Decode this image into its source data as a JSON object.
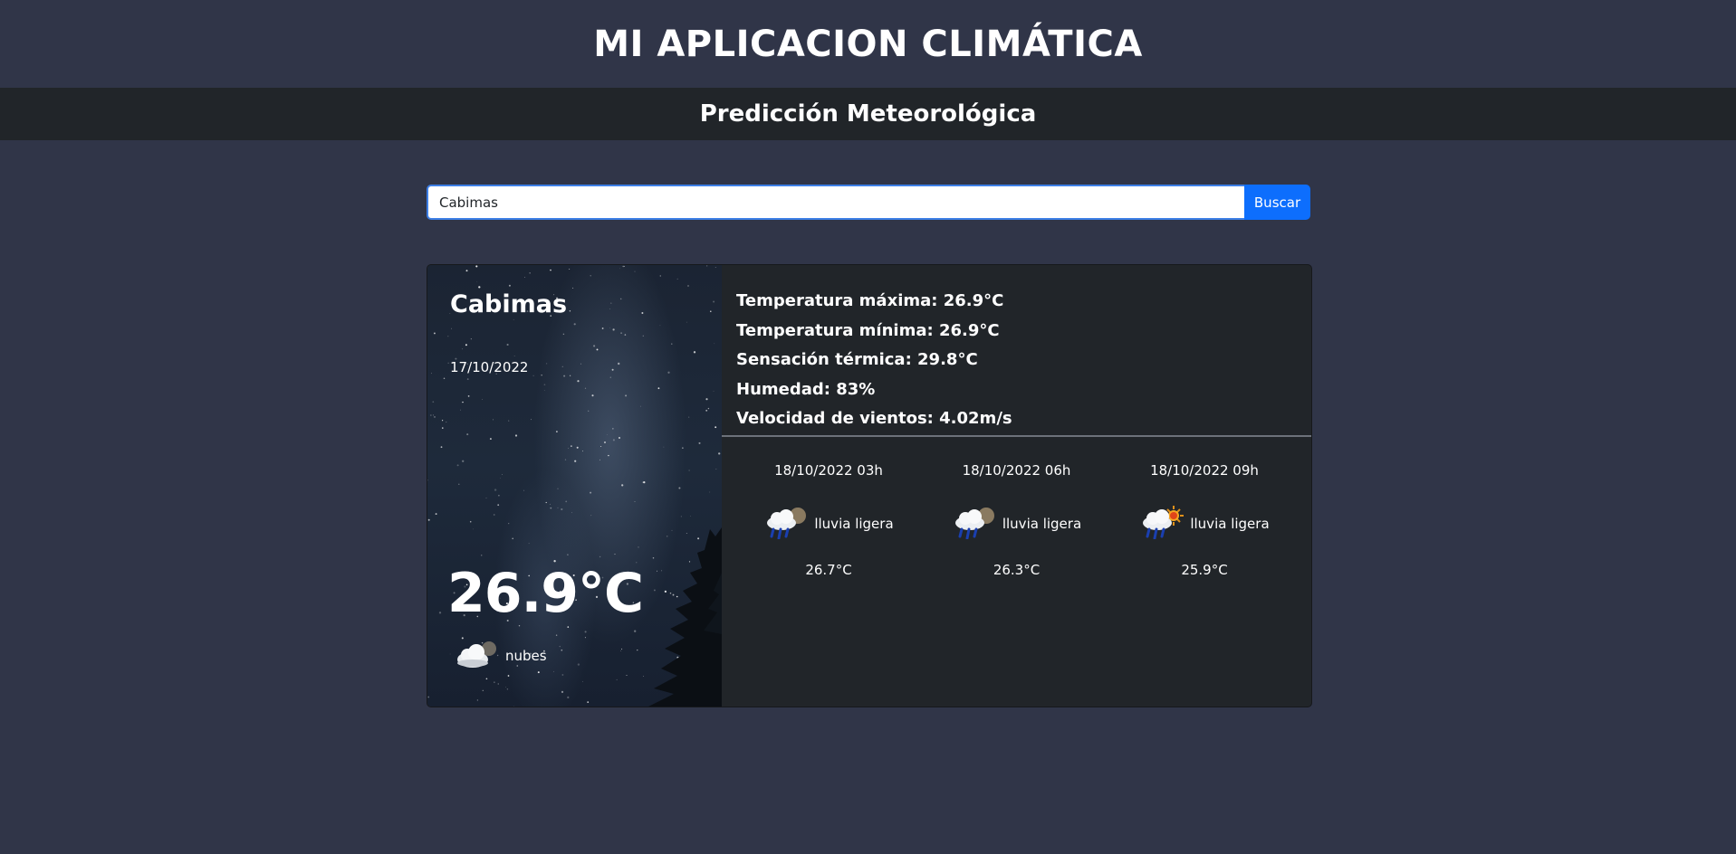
{
  "header": {
    "app_title": "MI APLICACION CLIMÁTICA",
    "subtitle": "Predicción Meteorológica"
  },
  "search": {
    "value": "Cabimas",
    "button_label": "Buscar"
  },
  "current": {
    "city": "Cabimas",
    "date": "17/10/2022",
    "temperature": "26.9°C",
    "condition": "nubes",
    "condition_icon": "cloud-night-icon"
  },
  "stats": {
    "max_temp": "Temperatura máxima: 26.9°C",
    "min_temp": "Temperatura mínima: 26.9°C",
    "feels_like": "Sensación térmica: 29.8°C",
    "humidity": "Humedad: 83%",
    "wind": "Velocidad de vientos: 4.02m/s"
  },
  "forecast": [
    {
      "datetime": "18/10/2022 03h",
      "condition": "lluvia ligera",
      "temperature": "26.7°C",
      "icon": "rain-night-icon"
    },
    {
      "datetime": "18/10/2022 06h",
      "condition": "lluvia ligera",
      "temperature": "26.3°C",
      "icon": "rain-night-icon"
    },
    {
      "datetime": "18/10/2022 09h",
      "condition": "lluvia ligera",
      "temperature": "25.9°C",
      "icon": "rain-sun-icon"
    }
  ],
  "colors": {
    "background": "#303548",
    "panel": "#212529",
    "accent": "#0d6efd"
  }
}
